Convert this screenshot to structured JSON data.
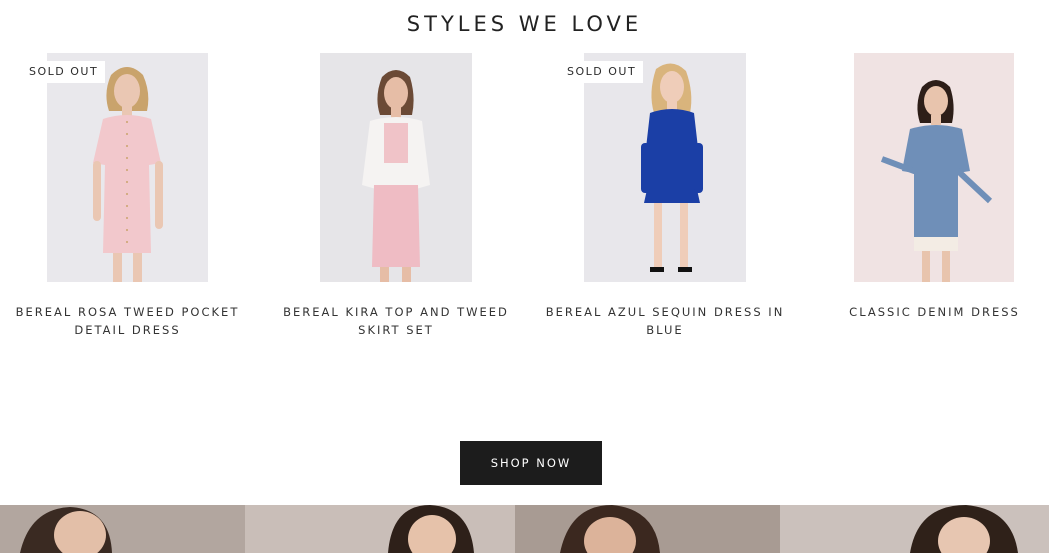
{
  "section": {
    "title": "STYLES WE LOVE"
  },
  "products": [
    {
      "name": "BEREAL ROSA TWEED POCKET DETAIL DRESS",
      "badge": "SOLD OUT"
    },
    {
      "name": "BEREAL KIRA TOP AND TWEED SKIRT SET",
      "badge": ""
    },
    {
      "name": "BEREAL AZUL SEQUIN DRESS IN BLUE",
      "badge": "SOLD OUT"
    },
    {
      "name": "CLASSIC DENIM DRESS",
      "badge": ""
    }
  ],
  "cta": {
    "label": "SHOP NOW"
  },
  "colors": {
    "button_bg": "#1c1c1c",
    "rosa_dress": "#f2c8cc",
    "azul_dress": "#1b3fa6",
    "denim_dress": "#6f8fb8"
  }
}
